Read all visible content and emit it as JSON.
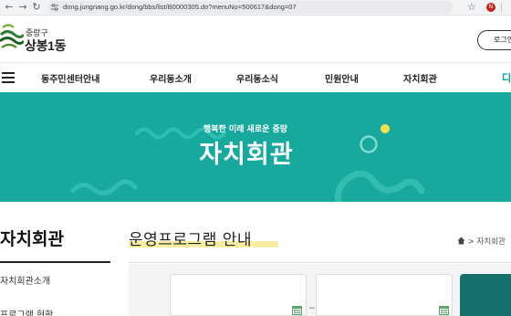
{
  "browser": {
    "url": "dong.jungnang.go.kr/dong/bbs/list/B0000305.do?menuNo=500617&dong=07",
    "back_icon": "arrow-left-icon",
    "forward_icon": "arrow-right-icon",
    "reload_icon": "reload-icon",
    "bookmark_icon": "star-icon",
    "extension_badge": "N"
  },
  "site": {
    "logo_sub": "중랑구",
    "logo_main": "상봉1동",
    "login_label": "로그인"
  },
  "gnb": {
    "items": [
      "동주민센터안내",
      "우리동소개",
      "우리동소식",
      "민원안내",
      "자치회관"
    ],
    "extra": "디"
  },
  "banner": {
    "subtitle": "행복한 미래 새로운 중랑",
    "title": "자치회관",
    "colors": {
      "background": "#17a99d",
      "accent_dot": "#f4e04d"
    }
  },
  "sidebar": {
    "title": "자치회관",
    "items": [
      "자치회관소개",
      "프로그램 현황"
    ]
  },
  "content": {
    "title": "운영프로그램 안내",
    "breadcrumb": [
      "자치회관"
    ],
    "date_separator": "~"
  },
  "colors": {
    "accent": "#17a99d",
    "highlight": "#f6ea8a",
    "search_button": "#15706a"
  }
}
